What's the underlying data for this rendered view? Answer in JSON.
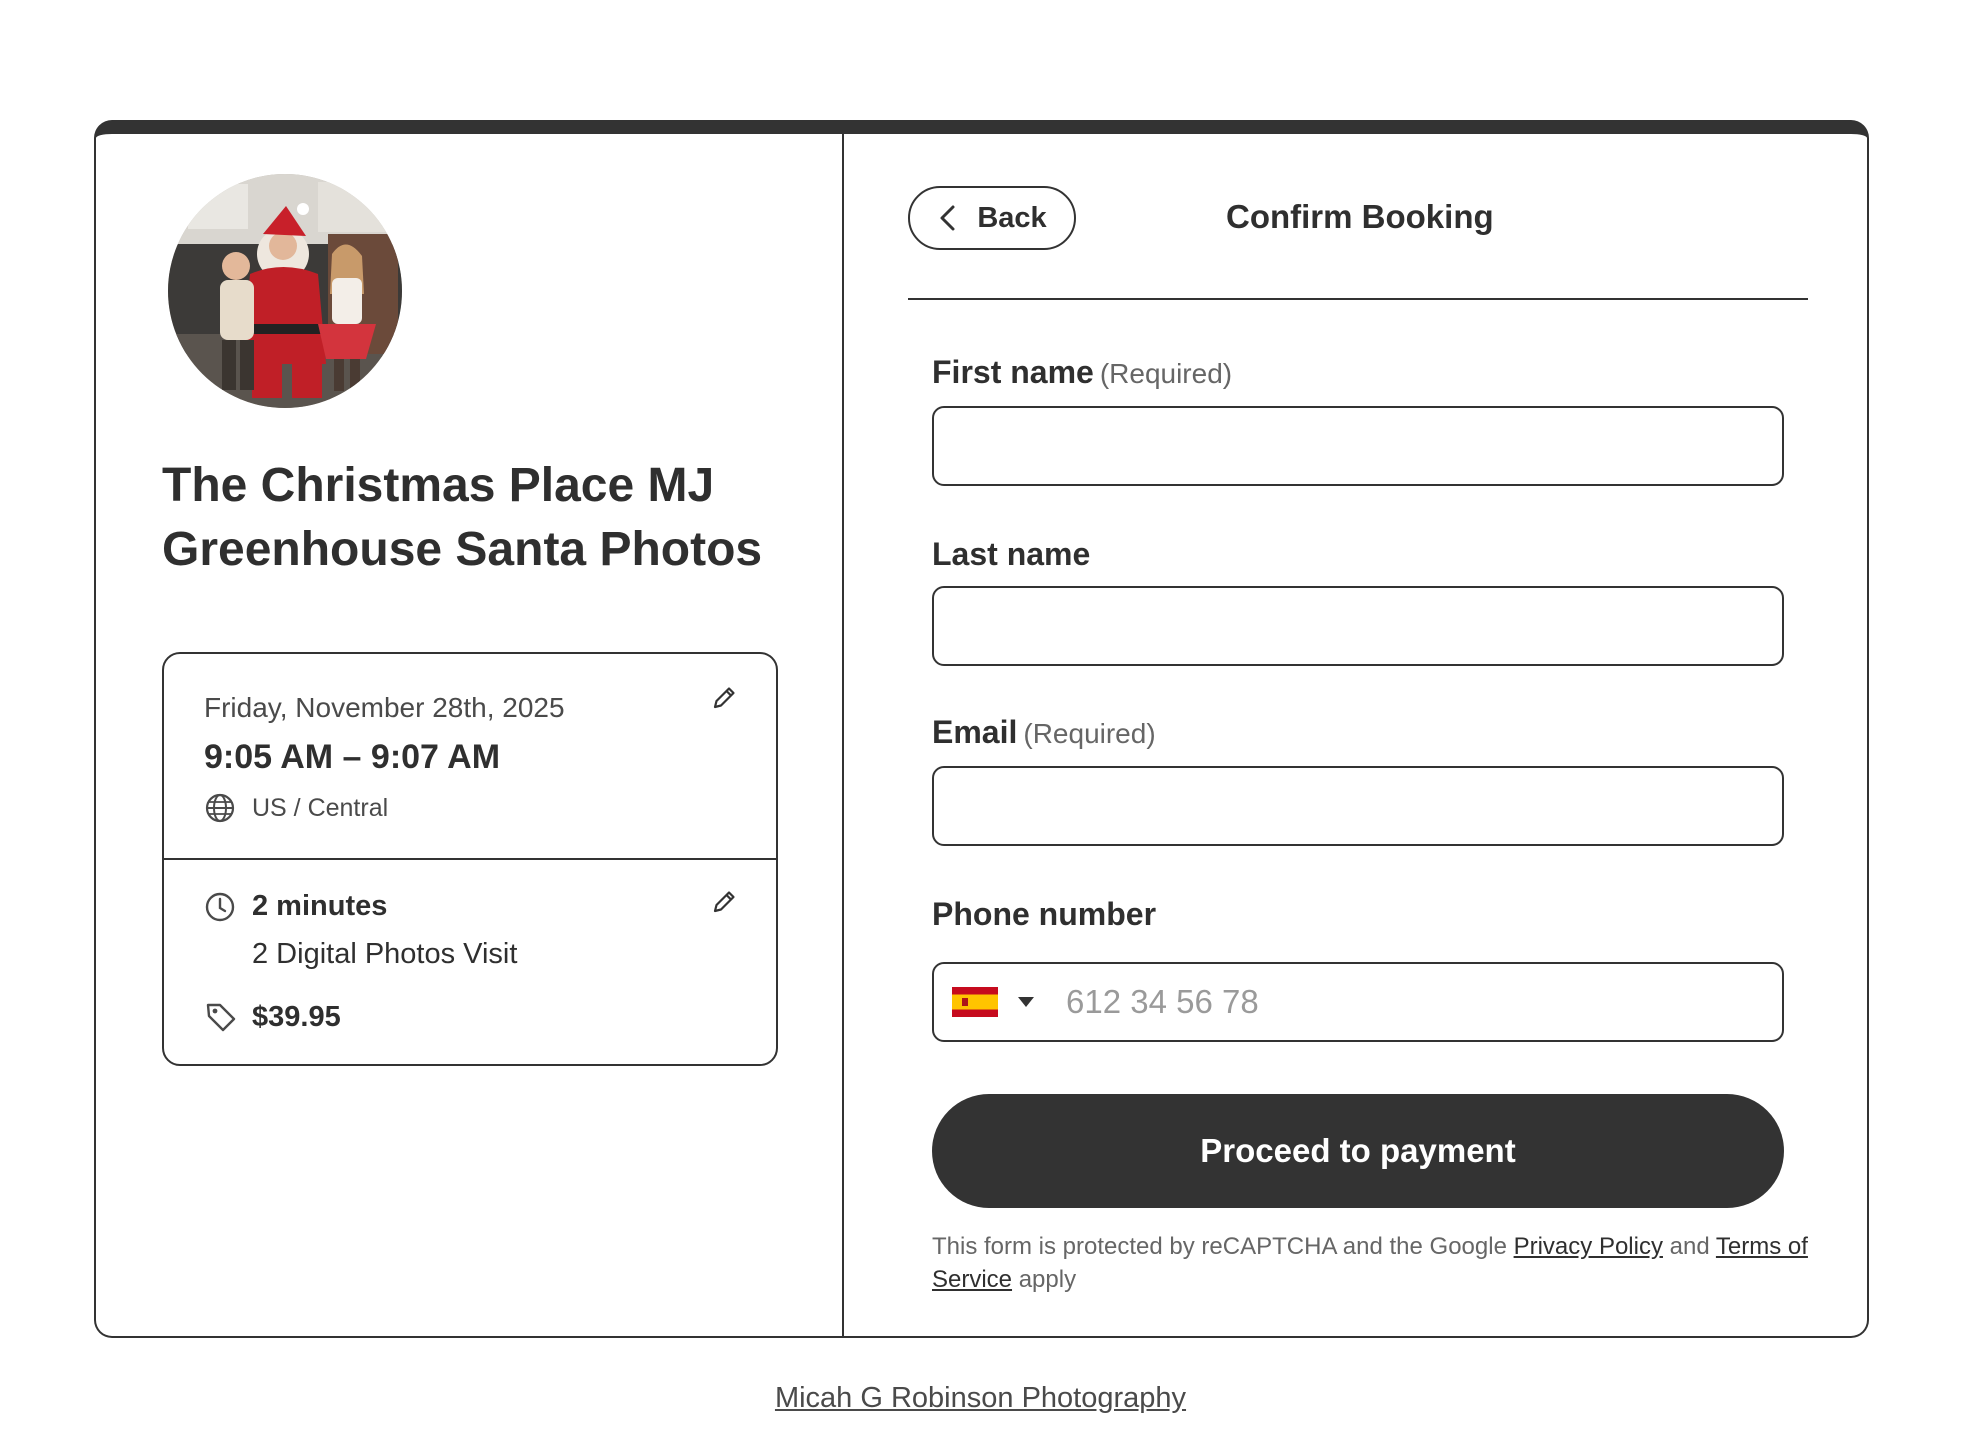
{
  "event": {
    "title": "The Christmas Place MJ Greenhouse Santa Photos",
    "date": "Friday, November 28th, 2025",
    "time_range": "9:05 AM – 9:07 AM",
    "timezone": "US / Central",
    "duration": "2 minutes",
    "service": "2 Digital Photos Visit",
    "price": "$39.95"
  },
  "header": {
    "back_label": "Back",
    "title": "Confirm Booking"
  },
  "form": {
    "first_name": {
      "label": "First name",
      "required": "(Required)",
      "value": ""
    },
    "last_name": {
      "label": "Last name",
      "value": ""
    },
    "email": {
      "label": "Email",
      "required": "(Required)",
      "value": ""
    },
    "phone": {
      "label": "Phone number",
      "placeholder": "612 34 56 78",
      "country": "ES",
      "value": ""
    },
    "submit_label": "Proceed to payment"
  },
  "recaptcha": {
    "prefix": "This form is protected by reCAPTCHA and the Google ",
    "privacy_link": "Privacy Policy",
    "middle": " and ",
    "terms_link": "Terms of Service",
    "suffix": " apply"
  },
  "footer": {
    "link": "Micah G Robinson Photography"
  },
  "icons": {
    "globe": "globe-icon",
    "clock": "clock-icon",
    "tag": "tag-icon",
    "edit": "pencil-icon",
    "back": "chevron-left-icon",
    "caret": "caret-down-icon"
  },
  "colors": {
    "accent": "#333333",
    "text": "#2f2f2f",
    "muted": "#666666",
    "flag_red": "#c60b1e",
    "flag_yellow": "#ffc400"
  }
}
